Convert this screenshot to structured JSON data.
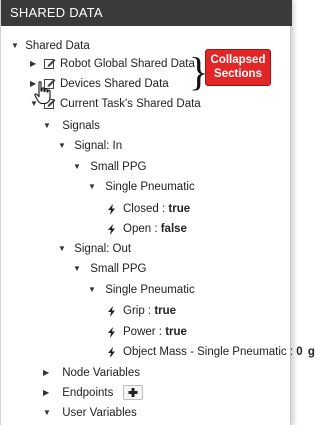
{
  "panel": {
    "title": "SHARED DATA"
  },
  "tree": {
    "shared_data": "Shared Data",
    "robot_global": "Robot Global Shared Data",
    "devices": "Devices Shared Data",
    "current_task": "Current Task's Shared Data",
    "signals": "Signals",
    "signal_in": {
      "label": "Signal: In",
      "group": "Small PPG",
      "device": "Single Pneumatic",
      "closed": {
        "name": "Closed : ",
        "value": "true"
      },
      "open": {
        "name": "Open : ",
        "value": "false"
      }
    },
    "signal_out": {
      "label": "Signal: Out",
      "group": "Small PPG",
      "device": "Single Pneumatic",
      "grip": {
        "name": "Grip : ",
        "value": "true"
      },
      "power": {
        "name": "Power : ",
        "value": "true"
      },
      "object_mass": {
        "name": "Object Mass - Single Pneumatic : ",
        "value": "0",
        "unit": "g"
      }
    },
    "node_variables": "Node Variables",
    "endpoints": "Endpoints",
    "user_variables": "User Variables"
  },
  "callout": {
    "line1": "Collapsed",
    "line2": "Sections",
    "color": "#e02626"
  },
  "icons": {
    "expanded": "triangle-down",
    "collapsed": "triangle-right",
    "edit": "edit-box-icon",
    "signal": "lightning-bolt-icon",
    "add": "plus-icon",
    "cursor": "hand-pointer-icon"
  }
}
